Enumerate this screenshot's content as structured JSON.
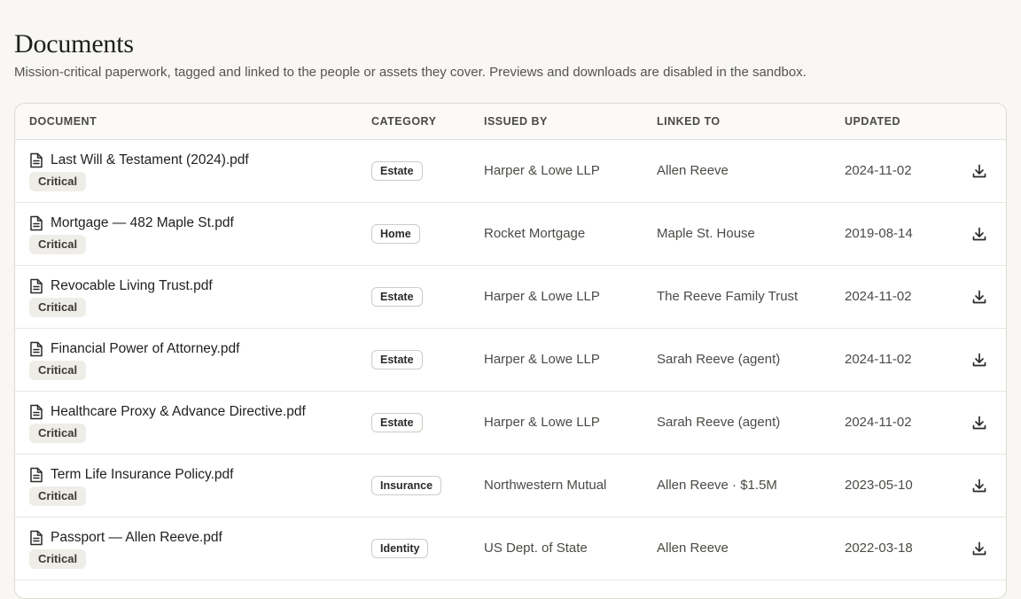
{
  "header": {
    "title": "Documents",
    "subtitle": "Mission-critical paperwork, tagged and linked to the people or assets they cover. Previews and downloads are disabled in the sandbox."
  },
  "table": {
    "columns": [
      "DOCUMENT",
      "CATEGORY",
      "ISSUED BY",
      "LINKED TO",
      "UPDATED"
    ],
    "rows": [
      {
        "name": "Last Will & Testament (2024).pdf",
        "tag": "Critical",
        "category": "Estate",
        "issued_by": "Harper & Lowe LLP",
        "linked_to": "Allen Reeve",
        "updated": "2024-11-02"
      },
      {
        "name": "Mortgage — 482 Maple St.pdf",
        "tag": "Critical",
        "category": "Home",
        "issued_by": "Rocket Mortgage",
        "linked_to": "Maple St. House",
        "updated": "2019-08-14"
      },
      {
        "name": "Revocable Living Trust.pdf",
        "tag": "Critical",
        "category": "Estate",
        "issued_by": "Harper & Lowe LLP",
        "linked_to": "The Reeve Family Trust",
        "updated": "2024-11-02"
      },
      {
        "name": "Financial Power of Attorney.pdf",
        "tag": "Critical",
        "category": "Estate",
        "issued_by": "Harper & Lowe LLP",
        "linked_to": "Sarah Reeve (agent)",
        "updated": "2024-11-02"
      },
      {
        "name": "Healthcare Proxy & Advance Directive.pdf",
        "tag": "Critical",
        "category": "Estate",
        "issued_by": "Harper & Lowe LLP",
        "linked_to": "Sarah Reeve (agent)",
        "updated": "2024-11-02"
      },
      {
        "name": "Term Life Insurance Policy.pdf",
        "tag": "Critical",
        "category": "Insurance",
        "issued_by": "Northwestern Mutual",
        "linked_to": "Allen Reeve · $1.5M",
        "updated": "2023-05-10"
      },
      {
        "name": "Passport — Allen Reeve.pdf",
        "tag": "Critical",
        "category": "Identity",
        "issued_by": "US Dept. of State",
        "linked_to": "Allen Reeve",
        "updated": "2022-03-18"
      }
    ]
  },
  "icons": {
    "document": "document-icon",
    "download": "download-icon"
  }
}
